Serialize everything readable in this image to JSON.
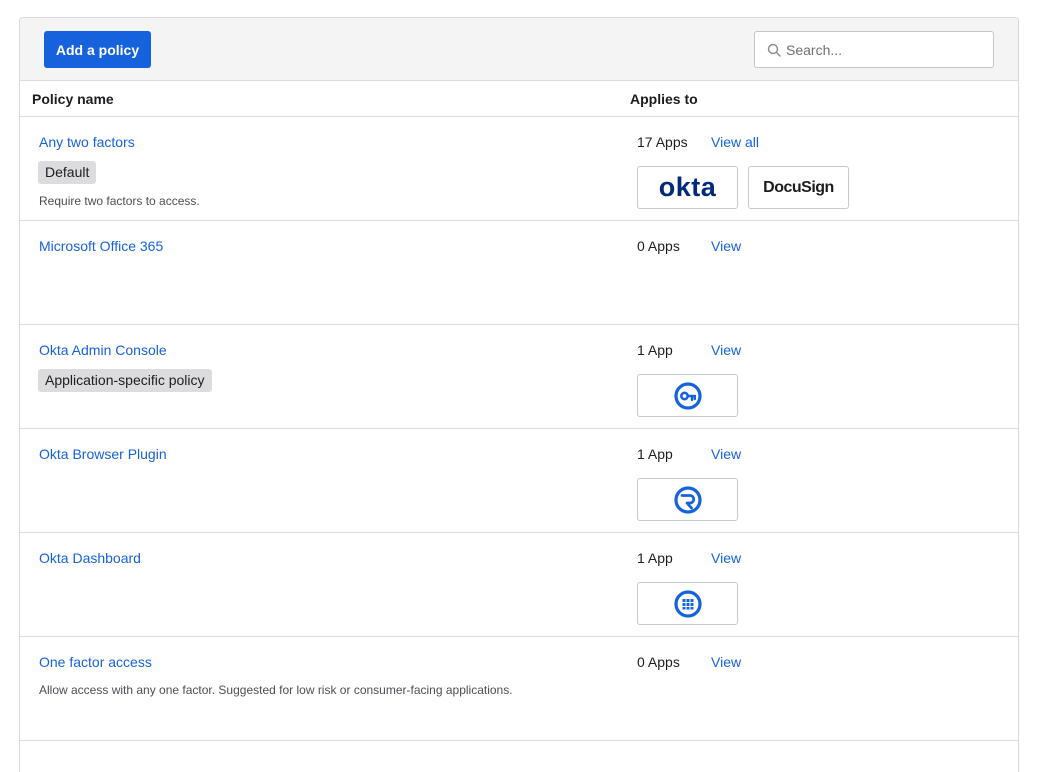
{
  "toolbar": {
    "add_label": "Add a policy",
    "search_placeholder": "Search..."
  },
  "table": {
    "col_policy_name": "Policy name",
    "col_applies_to": "Applies to"
  },
  "rows": [
    {
      "name": "Any two factors",
      "badge": "Default",
      "description": "Require two factors to access.",
      "app_count": "17 Apps",
      "view_label": "View all",
      "apps": [
        {
          "logo_text": "okta",
          "icon": "okta-logo"
        },
        {
          "logo_text": "DocuSign",
          "icon": "docusign-logo"
        }
      ]
    },
    {
      "name": "Microsoft Office 365",
      "app_count": "0 Apps",
      "view_label": "View"
    },
    {
      "name": "Okta Admin Console",
      "badge": "Application-specific policy",
      "app_count": "1 App",
      "view_label": "View",
      "apps": [
        {
          "icon": "key-icon"
        }
      ]
    },
    {
      "name": "Okta Browser Plugin",
      "app_count": "1 App",
      "view_label": "View",
      "apps": [
        {
          "icon": "browser-plugin-icon"
        }
      ]
    },
    {
      "name": "Okta Dashboard",
      "app_count": "1 App",
      "view_label": "View",
      "apps": [
        {
          "icon": "dashboard-grid-icon"
        }
      ]
    },
    {
      "name": "One factor access",
      "description": "Allow access with any one factor. Suggested for low risk or consumer-facing applications.",
      "app_count": "0 Apps",
      "view_label": "View"
    }
  ],
  "colors": {
    "primary": "#1662dd",
    "okta_navy": "#00297a",
    "badge_bg": "#dcdcdf"
  }
}
